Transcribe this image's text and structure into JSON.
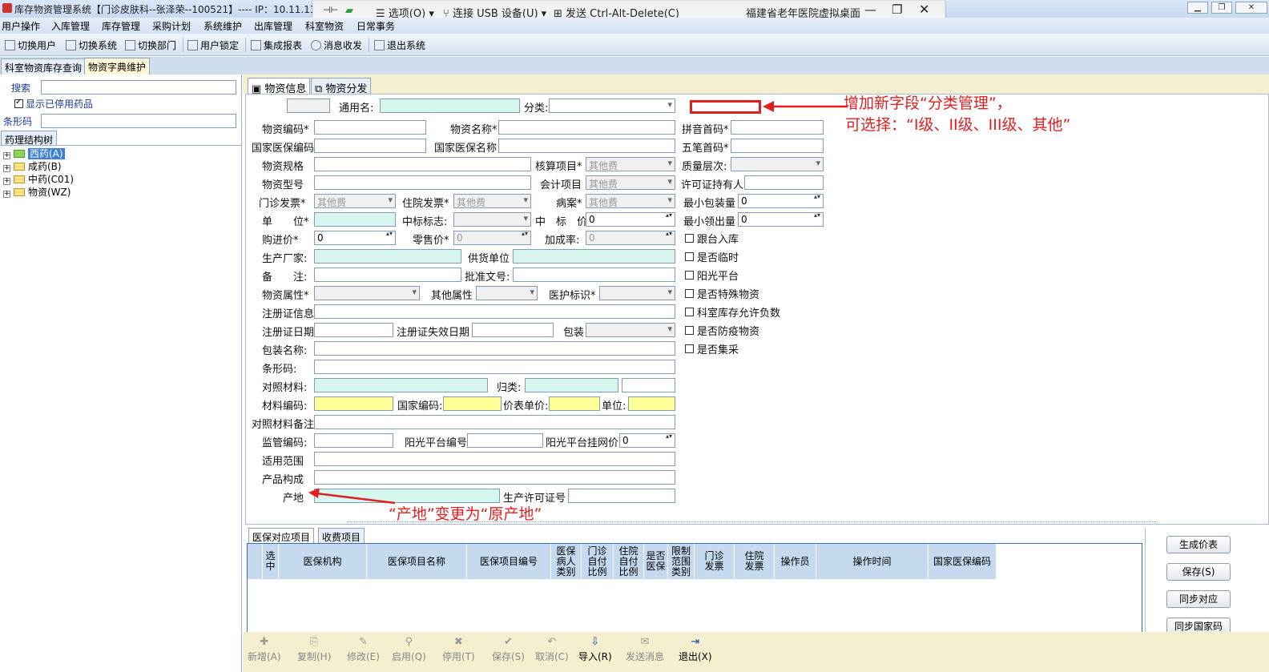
{
  "window": {
    "title": "库存物资管理系统【门诊皮肤科--张泽荣--100521】---- IP：10.11.11"
  },
  "usb": {
    "options": "选项(O)",
    "connect_usb": "连接 USB 设备(U)",
    "send_cad": "发送 Ctrl-Alt-Delete(C)",
    "host": "福建省老年医院虚拟桌面"
  },
  "menu": [
    "用户操作",
    "入库管理",
    "库存管理",
    "采购计划",
    "系统维护",
    "出库管理",
    "科室物资",
    "日常事务"
  ],
  "toolbar": [
    "切换用户",
    "切换系统",
    "切换部门",
    "用户锁定",
    "集成报表",
    "消息收发",
    "退出系统"
  ],
  "outer_tabs": [
    "科室物资库存查询",
    "物资字典维护"
  ],
  "left": {
    "search_label": "搜索",
    "show_disabled": "显示已停用药品",
    "barcode_label": "条形码",
    "tree_tab": "药理结构树",
    "tree": [
      "西药(A)",
      "成药(B)",
      "中药(C01)",
      "物资(WZ)"
    ]
  },
  "inner_tabs": [
    "物资信息",
    "物资分发"
  ],
  "form": {
    "generic_name": "通用名:",
    "category": "分类:",
    "code": "物资编码*",
    "name": "物资名称*",
    "pinyin": "拼音首码*",
    "ins_code": "国家医保编码",
    "ins_name": "国家医保名称",
    "wubi": "五笔首码*",
    "spec": "物资规格",
    "acct_item": "核算项目*",
    "acct_item_val": "其他费",
    "quality": "质量层次:",
    "model": "物资型号",
    "account": "会计项目",
    "account_val": "其他费",
    "license_holder": "许可证持有人",
    "op_invoice": "门诊发票*",
    "op_invoice_val": "其他费",
    "ip_invoice": "住院发票*",
    "ip_invoice_val": "其他费",
    "case": "病案*",
    "case_val": "其他费",
    "min_pack": "最小包装量",
    "min_pack_val": "0",
    "unit": "单　　位*",
    "bid_flag": "中标标志:",
    "bid_price": "中　标　价:",
    "bid_price_val": "0",
    "min_out": "最小领出量",
    "min_out_val": "0",
    "purchase_price": "购进价*",
    "purchase_price_val": "0",
    "retail_price": "零售价*",
    "retail_price_val": "0",
    "markup": "加成率:",
    "markup_val": "0",
    "manufacturer": "生产厂家:",
    "supplier": "供货单位",
    "remark": "备　　注:",
    "approval": "批准文号:",
    "attr": "物资属性*",
    "other_attr": "其他属性",
    "care_flag": "医护标识*",
    "reg_info": "注册证信息",
    "reg_date": "注册证日期",
    "reg_expire": "注册证失效日期",
    "package": "包装",
    "package_name": "包装名称:",
    "barcode": "条形码:",
    "ref_material": "对照材料:",
    "classify": "归类:",
    "material_code": "材料编码:",
    "national_code": "国家编码:",
    "list_price": "价表单价:",
    "unit2": "单位:",
    "ref_remark": "对照材料备注",
    "supervise_code": "监管编码:",
    "sun_code": "阳光平台编号",
    "sun_price": "阳光平台挂网价",
    "sun_price_val": "0",
    "scope": "适用范围",
    "composition": "产品构成",
    "origin": "产地",
    "prod_license": "生产许可证号",
    "checks": [
      "跟台入库",
      "是否临时",
      "阳光平台",
      "是否特殊物资",
      "科室库存允许负数",
      "是否防疫物资",
      "是否集采"
    ]
  },
  "annotations": {
    "a1": "增加新字段“分类管理”，",
    "a2": "可选择：“I级、II级、III级、其他”",
    "a3": "“产地”变更为“原产地”"
  },
  "grid_tabs": [
    "医保对应项目",
    "收费项目"
  ],
  "grid_headers": [
    "选中",
    "医保机构",
    "医保项目名称",
    "医保项目编号",
    "医保病人类别",
    "门诊自付比例",
    "住院自付比例",
    "是否医保",
    "限制范围类别",
    "门诊发票",
    "住院发票",
    "操作员",
    "操作时间",
    "国家医保编码"
  ],
  "buttons": [
    "生成价表",
    "保存(S)",
    "同步对应",
    "同步国家码"
  ],
  "bottom": [
    "新增(A)",
    "复制(H)",
    "修改(E)",
    "启用(Q)",
    "停用(T)",
    "保存(S)",
    "取消(C)",
    "导入(R)",
    "发送消息",
    "退出(X)"
  ],
  "colors": {
    "annotation": "#e02020",
    "cyan_field": "#d7f7ee",
    "yellow_field": "#ffff99"
  }
}
